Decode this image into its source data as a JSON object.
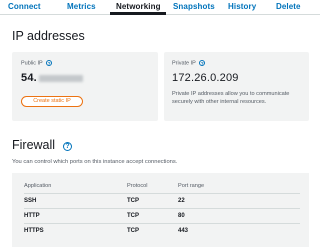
{
  "tabs": [
    "Connect",
    "Metrics",
    "Networking",
    "Snapshots",
    "History",
    "Delete"
  ],
  "ip_section": {
    "title": "IP addresses"
  },
  "public_ip": {
    "label": "Public IP",
    "value_prefix": "54.",
    "button": "Create static IP"
  },
  "private_ip": {
    "label": "Private IP",
    "value": "172.26.0.209",
    "description": "Private IP addresses allow you to communicate securely with other internal resources."
  },
  "firewall": {
    "title": "Firewall",
    "description": "You can control which ports on this instance accept connections.",
    "columns": [
      "Application",
      "Protocol",
      "Port range"
    ],
    "rows": [
      [
        "SSH",
        "TCP",
        "22"
      ],
      [
        "HTTP",
        "TCP",
        "80"
      ],
      [
        "HTTPS",
        "TCP",
        "443"
      ]
    ]
  },
  "colors": {
    "link": "#0073bb",
    "accent": "#ec7211",
    "text": "#16191f",
    "muted": "#545b64",
    "card": "#f2f3f3"
  },
  "icons": {
    "help": "help-circle-icon"
  }
}
